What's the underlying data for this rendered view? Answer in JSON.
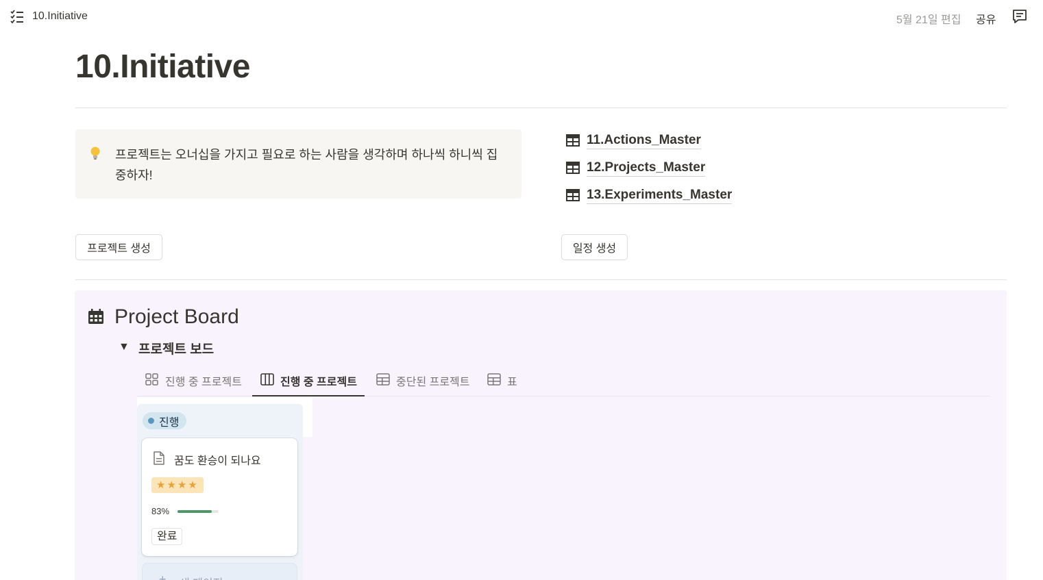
{
  "topbar": {
    "breadcrumb": "10.Initiative",
    "edited": "5월 21일 편집",
    "share": "공유"
  },
  "page": {
    "title": "10.Initiative"
  },
  "callout": {
    "icon": "lightbulb-icon",
    "text": "프로젝트는 오너십을 가지고 필요로 하는 사람을 생각하며 하나씩 하니씩 집중하자!"
  },
  "databases": [
    {
      "label": "11.Actions_Master",
      "icon": "table-icon"
    },
    {
      "label": "12.Projects_Master",
      "icon": "table-icon"
    },
    {
      "label": "13.Experiments_Master",
      "icon": "table-icon"
    }
  ],
  "buttons": {
    "create_project": "프로젝트 생성",
    "create_schedule": "일정 생성"
  },
  "board": {
    "title": "Project Board",
    "toggle_label": "프로젝트 보드",
    "tabs": [
      {
        "label": "진행 중 프로젝트",
        "icon": "gallery-icon",
        "active": false
      },
      {
        "label": "진행 중 프로젝트",
        "icon": "board-icon",
        "active": true
      },
      {
        "label": "중단된 프로젝트",
        "icon": "table-icon",
        "active": false
      },
      {
        "label": "표",
        "icon": "table-icon",
        "active": false
      }
    ],
    "column": {
      "status": "진행",
      "status_color": "#5b97bd"
    },
    "card": {
      "title": "꿈도 환승이 되나요",
      "rating": "★★★★",
      "rating_value": 4,
      "progress_label": "83%",
      "progress": 0.83,
      "status": "완료"
    },
    "new_page": "새 페이지"
  }
}
